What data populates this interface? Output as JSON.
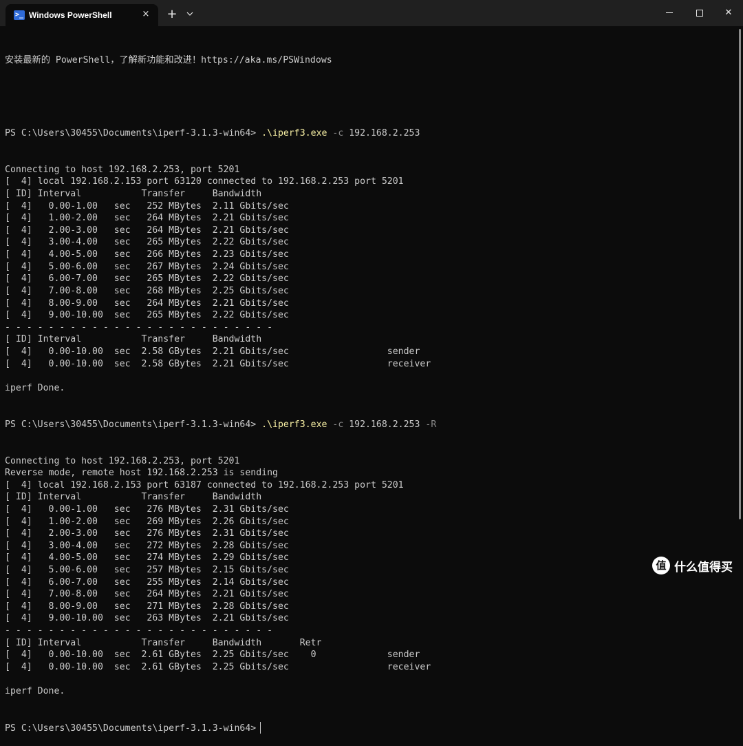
{
  "window": {
    "tab_title": "Windows PowerShell",
    "tab_icon": "powershell-icon",
    "tab_close": "×",
    "new_tab": "+",
    "dropdown": "chevron-down-icon",
    "minimize": "minimize-icon",
    "maximize": "maximize-icon",
    "close": "✕"
  },
  "console": {
    "banner": "安装最新的 PowerShell，了解新功能和改进！https://aka.ms/PSWindows",
    "run1": {
      "prompt": "PS C:\\Users\\30455\\Documents\\iperf-3.1.3-win64> ",
      "command": ".\\iperf3.exe",
      "args": " -c ",
      "target": "192.168.2.253",
      "output": [
        "Connecting to host 192.168.2.253, port 5201",
        "[  4] local 192.168.2.153 port 63120 connected to 192.168.2.253 port 5201",
        "[ ID] Interval           Transfer     Bandwidth",
        "[  4]   0.00-1.00   sec   252 MBytes  2.11 Gbits/sec",
        "[  4]   1.00-2.00   sec   264 MBytes  2.21 Gbits/sec",
        "[  4]   2.00-3.00   sec   264 MBytes  2.21 Gbits/sec",
        "[  4]   3.00-4.00   sec   265 MBytes  2.22 Gbits/sec",
        "[  4]   4.00-5.00   sec   266 MBytes  2.23 Gbits/sec",
        "[  4]   5.00-6.00   sec   267 MBytes  2.24 Gbits/sec",
        "[  4]   6.00-7.00   sec   265 MBytes  2.22 Gbits/sec",
        "[  4]   7.00-8.00   sec   268 MBytes  2.25 Gbits/sec",
        "[  4]   8.00-9.00   sec   264 MBytes  2.21 Gbits/sec",
        "[  4]   9.00-10.00  sec   265 MBytes  2.22 Gbits/sec",
        "- - - - - - - - - - - - - - - - - - - - - - - - -",
        "[ ID] Interval           Transfer     Bandwidth",
        "[  4]   0.00-10.00  sec  2.58 GBytes  2.21 Gbits/sec                  sender",
        "[  4]   0.00-10.00  sec  2.58 GBytes  2.21 Gbits/sec                  receiver",
        "",
        "iperf Done."
      ]
    },
    "run2": {
      "prompt": "PS C:\\Users\\30455\\Documents\\iperf-3.1.3-win64> ",
      "command": ".\\iperf3.exe",
      "args1": " -c ",
      "target": "192.168.2.253",
      "args2": " -R",
      "output": [
        "Connecting to host 192.168.2.253, port 5201",
        "Reverse mode, remote host 192.168.2.253 is sending",
        "[  4] local 192.168.2.153 port 63187 connected to 192.168.2.253 port 5201",
        "[ ID] Interval           Transfer     Bandwidth",
        "[  4]   0.00-1.00   sec   276 MBytes  2.31 Gbits/sec",
        "[  4]   1.00-2.00   sec   269 MBytes  2.26 Gbits/sec",
        "[  4]   2.00-3.00   sec   276 MBytes  2.31 Gbits/sec",
        "[  4]   3.00-4.00   sec   272 MBytes  2.28 Gbits/sec",
        "[  4]   4.00-5.00   sec   274 MBytes  2.29 Gbits/sec",
        "[  4]   5.00-6.00   sec   257 MBytes  2.15 Gbits/sec",
        "[  4]   6.00-7.00   sec   255 MBytes  2.14 Gbits/sec",
        "[  4]   7.00-8.00   sec   264 MBytes  2.21 Gbits/sec",
        "[  4]   8.00-9.00   sec   271 MBytes  2.28 Gbits/sec",
        "[  4]   9.00-10.00  sec   263 MBytes  2.21 Gbits/sec",
        "- - - - - - - - - - - - - - - - - - - - - - - - -",
        "[ ID] Interval           Transfer     Bandwidth       Retr",
        "[  4]   0.00-10.00  sec  2.61 GBytes  2.25 Gbits/sec    0             sender",
        "[  4]   0.00-10.00  sec  2.61 GBytes  2.25 Gbits/sec                  receiver",
        "",
        "iperf Done."
      ]
    },
    "final_prompt": "PS C:\\Users\\30455\\Documents\\iperf-3.1.3-win64>"
  },
  "watermark": {
    "badge": "值",
    "text": "什么值得买"
  },
  "colors": {
    "background": "#0c0c0c",
    "titlebar": "#202020",
    "text": "#cccccc",
    "command": "#f9f1a5",
    "parameter": "#8a8a8a"
  }
}
